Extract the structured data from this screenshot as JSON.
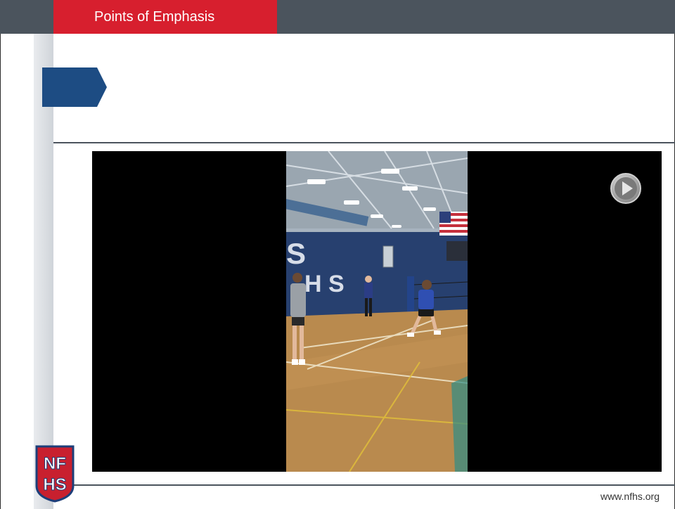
{
  "header": {
    "section_label": "Points of Emphasis"
  },
  "logo": {
    "text": "NFHS"
  },
  "video": {
    "play_icon": "play-icon"
  },
  "footer": {
    "url": "www.nfhs.org"
  },
  "colors": {
    "accent_red": "#d71f2e",
    "bar_gray": "#4b545d",
    "chevron_blue": "#1d4c83"
  }
}
